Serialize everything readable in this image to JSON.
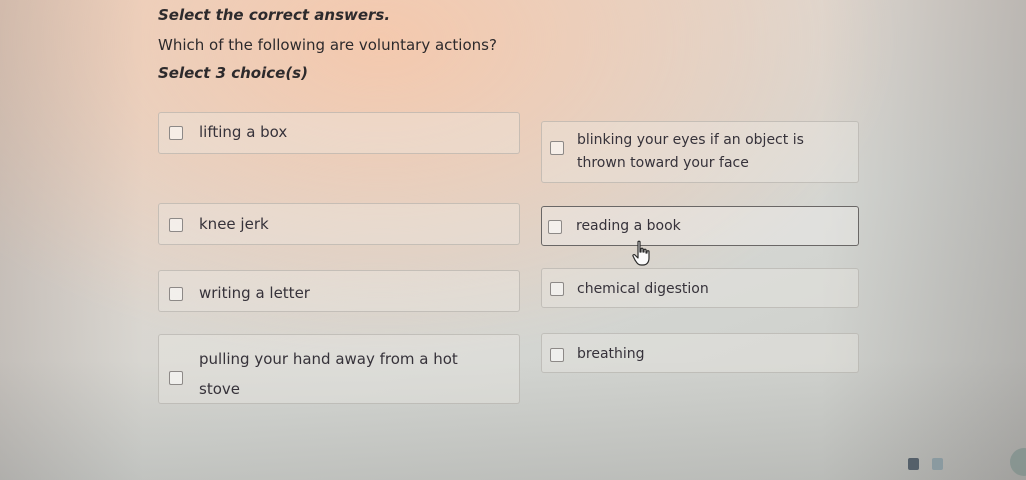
{
  "header": {
    "instruction": "Select the correct answers.",
    "question": "Which of the following are voluntary actions?",
    "select_count": "Select 3 choice(s)"
  },
  "choices": {
    "left": [
      {
        "line1": "lifting a box",
        "line2": "",
        "checked": false
      },
      {
        "line1": "knee jerk",
        "line2": "",
        "checked": false
      },
      {
        "line1": "writing a letter",
        "line2": "",
        "checked": false
      },
      {
        "line1": "pulling your hand away from a hot",
        "line2": "stove",
        "checked": false
      }
    ],
    "right": [
      {
        "line1": "blinking your eyes if an object is",
        "line2": "thrown toward your face",
        "checked": false
      },
      {
        "line1": "reading a book",
        "line2": "",
        "checked": false,
        "hovered": true
      },
      {
        "line1": "chemical digestion",
        "line2": "",
        "checked": false
      },
      {
        "line1": "breathing",
        "line2": "",
        "checked": false
      }
    ]
  },
  "colors": {
    "accent": "#6a6766",
    "text": "#2d2a2c",
    "checkbox_border": "#8d8987"
  },
  "icons": {
    "cursor": "hand-pointer-icon"
  }
}
